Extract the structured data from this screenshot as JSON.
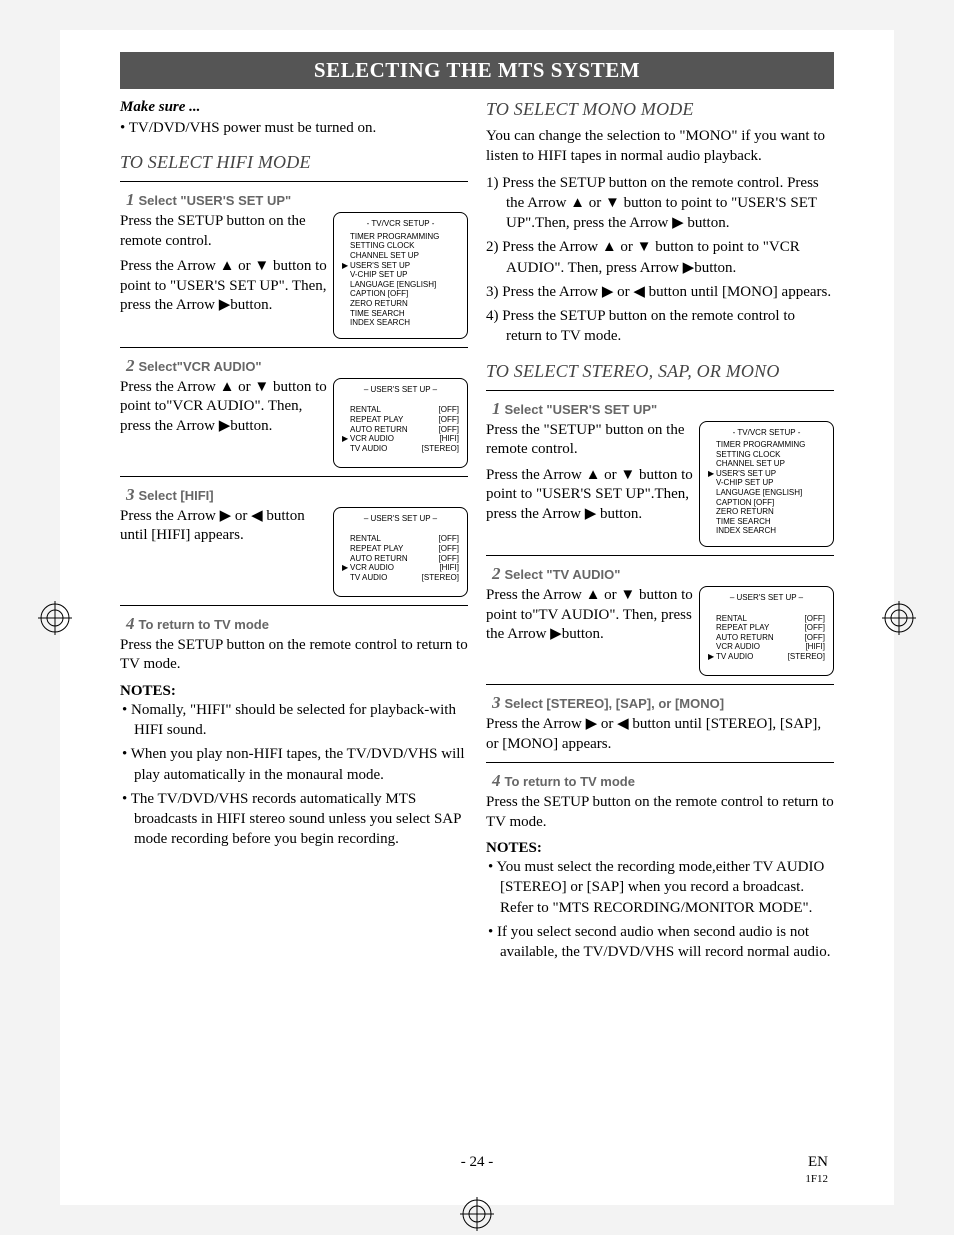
{
  "banner": "SELECTING THE MTS SYSTEM",
  "makesure_label": "Make sure ...",
  "makesure_item": "TV/DVD/VHS power must be turned on.",
  "left": {
    "section": "TO SELECT HIFI MODE",
    "steps": {
      "s1": {
        "num": "1",
        "head": "Select \"USER'S SET UP\"",
        "text": "Press the SETUP button on the remote control.",
        "text2": "Press the Arrow ▲ or ▼ button to point to \"USER'S SET UP\". Then, press the Arrow ▶button."
      },
      "s2": {
        "num": "2",
        "head": "Select\"VCR AUDIO\"",
        "text": "Press the Arrow ▲ or ▼ button to point to\"VCR AUDIO\". Then, press the Arrow ▶button."
      },
      "s3": {
        "num": "3",
        "head": "Select [HIFI]",
        "text": "Press the Arrow ▶ or ◀ button until [HIFI] appears."
      },
      "s4": {
        "num": "4",
        "head": "To return to TV mode",
        "text": "Press the SETUP button on the remote control to return to TV mode."
      }
    },
    "notes_head": "NOTES:",
    "notes": {
      "n1": "Nomally, \"HIFI\" should be selected for playback-with HIFI sound.",
      "n2": "When you play non-HIFI tapes, the TV/DVD/VHS will play automatically in the monaural mode.",
      "n3": "The TV/DVD/VHS records automatically MTS broadcasts in HIFI stereo sound unless you select SAP mode recording before you begin recording."
    },
    "osd1": {
      "title": "- TV/VCR SETUP -",
      "lines": {
        "l0": {
          "ptr": "",
          "lbl": "TIMER PROGRAMMING",
          "val": ""
        },
        "l1": {
          "ptr": "",
          "lbl": "SETTING CLOCK",
          "val": ""
        },
        "l2": {
          "ptr": "",
          "lbl": "CHANNEL SET UP",
          "val": ""
        },
        "l3": {
          "ptr": "▶",
          "lbl": "USER'S SET UP",
          "val": ""
        },
        "l4": {
          "ptr": "",
          "lbl": "V-CHIP SET UP",
          "val": ""
        },
        "l5": {
          "ptr": "",
          "lbl": "LANGUAGE  [ENGLISH]",
          "val": ""
        },
        "l6": {
          "ptr": "",
          "lbl": "CAPTION   [OFF]",
          "val": ""
        },
        "l7": {
          "ptr": "",
          "lbl": "ZERO RETURN",
          "val": ""
        },
        "l8": {
          "ptr": "",
          "lbl": "TIME SEARCH",
          "val": ""
        },
        "l9": {
          "ptr": "",
          "lbl": "INDEX SEARCH",
          "val": ""
        }
      }
    },
    "osd2": {
      "title": "– USER'S SET UP –",
      "lines": {
        "l0": {
          "ptr": "",
          "lbl": "RENTAL",
          "val": "[OFF]"
        },
        "l1": {
          "ptr": "",
          "lbl": "REPEAT PLAY",
          "val": "[OFF]"
        },
        "l2": {
          "ptr": "",
          "lbl": "AUTO RETURN",
          "val": "[OFF]"
        },
        "l3": {
          "ptr": "▶",
          "lbl": "VCR AUDIO",
          "val": "[HIFI]"
        },
        "l4": {
          "ptr": "",
          "lbl": "TV AUDIO",
          "val": "[STEREO]"
        }
      }
    },
    "osd3": {
      "title": "– USER'S SET UP –",
      "lines": {
        "l0": {
          "ptr": "",
          "lbl": "RENTAL",
          "val": "[OFF]"
        },
        "l1": {
          "ptr": "",
          "lbl": "REPEAT PLAY",
          "val": "[OFF]"
        },
        "l2": {
          "ptr": "",
          "lbl": "AUTO RETURN",
          "val": "[OFF]"
        },
        "l3": {
          "ptr": "▶",
          "lbl": "VCR AUDIO",
          "val": "[HIFI]"
        },
        "l4": {
          "ptr": "",
          "lbl": "TV AUDIO",
          "val": "[STEREO]"
        }
      }
    }
  },
  "right": {
    "section_mono": "TO SELECT MONO MODE",
    "mono_intro": "You can change the selection to \"MONO\" if you want to listen to HIFI tapes in normal audio playback.",
    "mono_steps": {
      "m1": "1) Press the SETUP button on the remote control. Press the Arrow ▲ or ▼ button to point to \"USER'S SET UP\".Then, press the Arrow ▶ button.",
      "m2": "2) Press the Arrow ▲ or ▼ button to point to \"VCR AUDIO\". Then, press Arrow ▶button.",
      "m3": "3) Press the Arrow ▶ or ◀ button until [MONO] appears.",
      "m4": "4) Press the SETUP button on the remote control to return to TV mode."
    },
    "section_sap": "TO SELECT STEREO, SAP, OR MONO",
    "sap_steps": {
      "s1": {
        "num": "1",
        "head": "Select \"USER'S SET UP\"",
        "text": "Press the \"SETUP\" button on the remote control.",
        "text2": "Press the Arrow ▲ or ▼ button to point to \"USER'S SET UP\".Then, press the Arrow ▶ button."
      },
      "s2": {
        "num": "2",
        "head": "Select \"TV AUDIO\"",
        "text": "Press the Arrow ▲ or ▼ button to point to\"TV AUDIO\". Then, press the Arrow ▶button."
      },
      "s3": {
        "num": "3",
        "head": "Select [STEREO], [SAP], or [MONO]",
        "text": "Press the Arrow ▶ or ◀ button until [STEREO], [SAP], or [MONO] appears."
      },
      "s4": {
        "num": "4",
        "head": "To return to TV mode",
        "text": "Press the SETUP button on the remote control to return to TV mode."
      }
    },
    "notes_head": "NOTES:",
    "notes": {
      "n1": "You must select the recording mode,either TV AUDIO [STEREO] or [SAP] when you record a broadcast.\nRefer to \"MTS RECORDING/MONITOR MODE\".",
      "n2": "If you select second audio when second audio is not available, the TV/DVD/VHS will record normal audio."
    },
    "osd1": {
      "title": "- TV/VCR SETUP -",
      "lines": {
        "l0": {
          "ptr": "",
          "lbl": "TIMER PROGRAMMING",
          "val": ""
        },
        "l1": {
          "ptr": "",
          "lbl": "SETTING CLOCK",
          "val": ""
        },
        "l2": {
          "ptr": "",
          "lbl": "CHANNEL SET UP",
          "val": ""
        },
        "l3": {
          "ptr": "▶",
          "lbl": "USER'S SET UP",
          "val": ""
        },
        "l4": {
          "ptr": "",
          "lbl": "V-CHIP SET UP",
          "val": ""
        },
        "l5": {
          "ptr": "",
          "lbl": "LANGUAGE  [ENGLISH]",
          "val": ""
        },
        "l6": {
          "ptr": "",
          "lbl": "CAPTION   [OFF]",
          "val": ""
        },
        "l7": {
          "ptr": "",
          "lbl": "ZERO RETURN",
          "val": ""
        },
        "l8": {
          "ptr": "",
          "lbl": "TIME SEARCH",
          "val": ""
        },
        "l9": {
          "ptr": "",
          "lbl": "INDEX SEARCH",
          "val": ""
        }
      }
    },
    "osd2": {
      "title": "– USER'S SET UP –",
      "lines": {
        "l0": {
          "ptr": "",
          "lbl": "RENTAL",
          "val": "[OFF]"
        },
        "l1": {
          "ptr": "",
          "lbl": "REPEAT PLAY",
          "val": "[OFF]"
        },
        "l2": {
          "ptr": "",
          "lbl": "AUTO RETURN",
          "val": "[OFF]"
        },
        "l3": {
          "ptr": "",
          "lbl": "VCR AUDIO",
          "val": "[HIFI]"
        },
        "l4": {
          "ptr": "▶",
          "lbl": "TV AUDIO",
          "val": "[STEREO]"
        }
      }
    }
  },
  "footer": {
    "page": "- 24 -",
    "lang": "EN",
    "code": "1F12"
  }
}
